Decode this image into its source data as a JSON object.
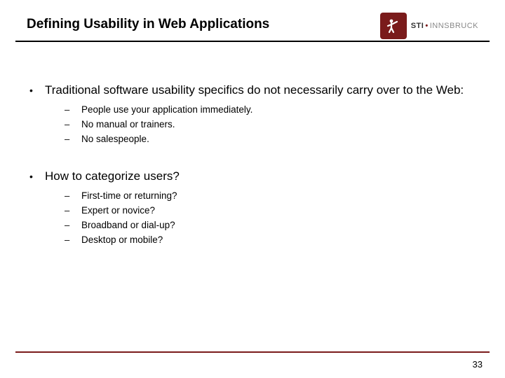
{
  "title": "Defining Usability in Web Applications",
  "brand": {
    "sti": "STI",
    "dot": "•",
    "inn": "INNSBRUCK"
  },
  "bullets": [
    {
      "text": "Traditional software usability specifics do not necessarily carry over to the Web:",
      "sub": [
        "People use your application immediately.",
        "No manual or trainers.",
        "No salespeople."
      ]
    },
    {
      "text": "How to categorize users?",
      "sub": [
        "First-time or returning?",
        "Expert or novice?",
        "Broadband or dial-up?",
        "Desktop or mobile?"
      ]
    }
  ],
  "pageNumber": "33",
  "bulletChar": "•",
  "dashChar": "–"
}
